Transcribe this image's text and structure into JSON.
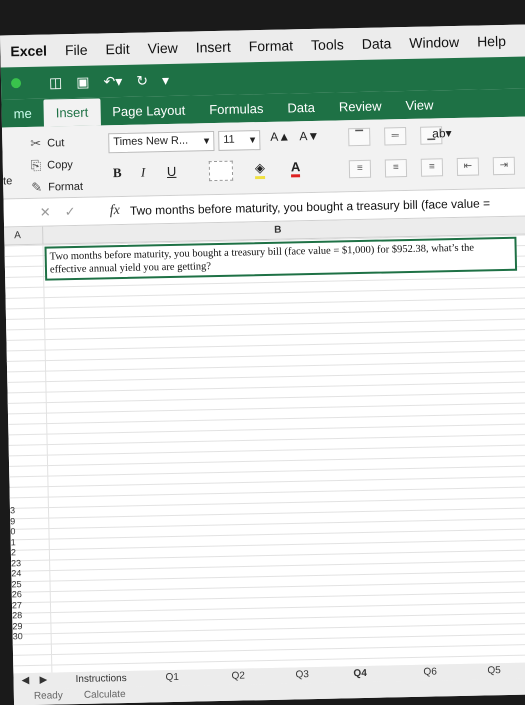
{
  "menu": {
    "app": "Excel",
    "items": [
      "File",
      "Edit",
      "View",
      "Insert",
      "Format",
      "Tools",
      "Data",
      "Window",
      "Help"
    ]
  },
  "ribbon_tabs": [
    "me",
    "Insert",
    "Page Layout",
    "Formulas",
    "Data",
    "Review",
    "View"
  ],
  "clipboard": {
    "cut": "Cut",
    "copy": "Copy",
    "format": "Format",
    "paste_partial": "te"
  },
  "font": {
    "name": "Times New R...",
    "size": "11",
    "bold": "B",
    "italic": "I",
    "underline": "U",
    "color_letter": "A",
    "grow": "A▲",
    "shrink": "A▼"
  },
  "formula_bar": {
    "fx": "fx",
    "text": "Two months before maturity, you bought a treasury bill (face value ="
  },
  "columns": [
    "A",
    "B"
  ],
  "cell_b1": "Two months before maturity, you bought a treasury bill (face value = $1,000) for $952.38, what’s the effective annual yield you are getting?",
  "row_numbers": [
    "3",
    "9",
    "0",
    "1",
    "2",
    "23",
    "24",
    "25",
    "26",
    "27",
    "28",
    "29",
    "30"
  ],
  "sheets": [
    "Instructions",
    "Q1",
    "Q2",
    "Q3",
    "Q4",
    "Q6",
    "Q5"
  ],
  "status": {
    "ready": "Ready",
    "calculate": "Calculate"
  },
  "colors": {
    "accent": "#1e7145",
    "close_dot": "#39c24c"
  }
}
